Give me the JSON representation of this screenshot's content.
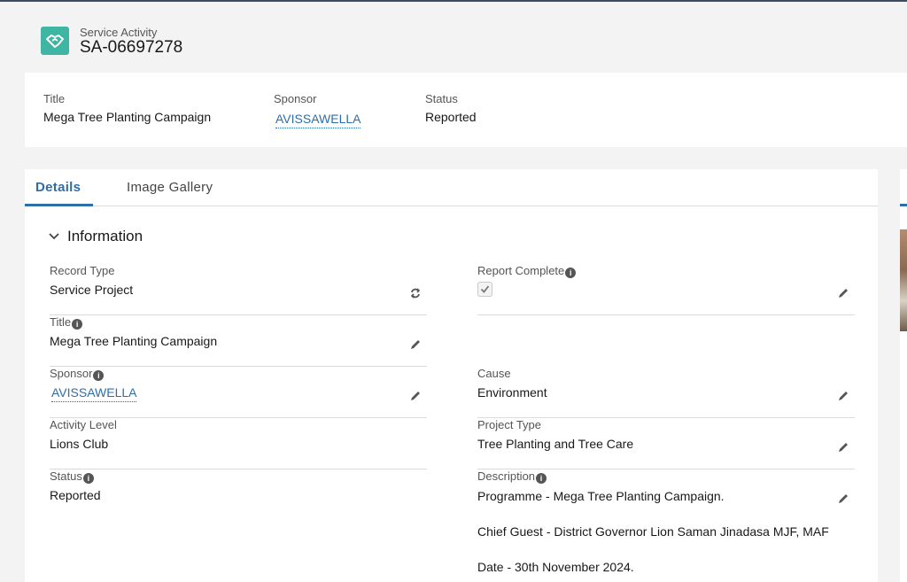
{
  "header": {
    "object_type": "Service Activity",
    "record_name": "SA-06697278",
    "icon": "handshake-icon"
  },
  "highlights": {
    "title_label": "Title",
    "title_value": "Mega Tree Planting Campaign",
    "sponsor_label": "Sponsor",
    "sponsor_value": "AVISSAWELLA",
    "status_label": "Status",
    "status_value": "Reported"
  },
  "tabs": [
    {
      "label": "Details",
      "active": true
    },
    {
      "label": "Image Gallery",
      "active": false
    }
  ],
  "section": {
    "title": "Information"
  },
  "fields": {
    "record_type": {
      "label": "Record Type",
      "value": "Service Project"
    },
    "report_complete": {
      "label": "Report Complete",
      "checked": true
    },
    "title": {
      "label": "Title",
      "value": "Mega Tree Planting Campaign"
    },
    "sponsor": {
      "label": "Sponsor",
      "value": "AVISSAWELLA"
    },
    "cause": {
      "label": "Cause",
      "value": "Environment"
    },
    "activity_level": {
      "label": "Activity Level",
      "value": "Lions Club"
    },
    "project_type": {
      "label": "Project Type",
      "value": "Tree Planting and Tree Care"
    },
    "status": {
      "label": "Status",
      "value": "Reported"
    },
    "description": {
      "label": "Description",
      "lines": [
        "Programme - Mega Tree Planting Campaign.",
        "Chief Guest - District Governor Lion Saman Jinadasa MJF, MAF",
        "Date - 30th November 2024."
      ]
    }
  },
  "colors": {
    "accent": "#2e6ea8",
    "icon_bg": "#3fb5a3",
    "background": "#f3f3f3"
  }
}
